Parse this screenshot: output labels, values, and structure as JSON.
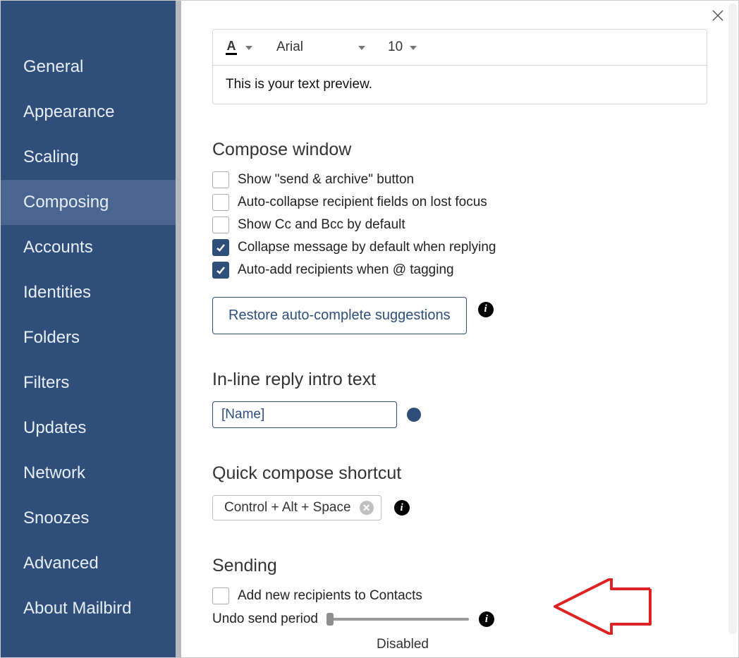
{
  "sidebar": {
    "items": [
      {
        "label": "General"
      },
      {
        "label": "Appearance"
      },
      {
        "label": "Scaling"
      },
      {
        "label": "Composing"
      },
      {
        "label": "Accounts"
      },
      {
        "label": "Identities"
      },
      {
        "label": "Folders"
      },
      {
        "label": "Filters"
      },
      {
        "label": "Updates"
      },
      {
        "label": "Network"
      },
      {
        "label": "Snoozes"
      },
      {
        "label": "Advanced"
      },
      {
        "label": "About Mailbird"
      }
    ],
    "active_index": 3
  },
  "format": {
    "font_name": "Arial",
    "font_size": "10",
    "preview_text": "This is your text preview."
  },
  "compose_window": {
    "heading": "Compose window",
    "options": [
      {
        "label": "Show \"send & archive\" button",
        "checked": false
      },
      {
        "label": "Auto-collapse recipient fields on lost focus",
        "checked": false
      },
      {
        "label": "Show Cc and Bcc by default",
        "checked": false
      },
      {
        "label": "Collapse message by default when replying",
        "checked": true
      },
      {
        "label": "Auto-add recipients when @ tagging",
        "checked": true
      }
    ],
    "restore_btn": "Restore auto-complete suggestions"
  },
  "inline_reply": {
    "heading": "In-line reply intro text",
    "value": "[Name]"
  },
  "quick_compose": {
    "heading": "Quick compose shortcut",
    "value": "Control + Alt + Space"
  },
  "sending": {
    "heading": "Sending",
    "add_contacts_label": "Add new recipients to Contacts",
    "add_contacts_checked": false,
    "undo_label": "Undo send period",
    "undo_status": "Disabled"
  }
}
